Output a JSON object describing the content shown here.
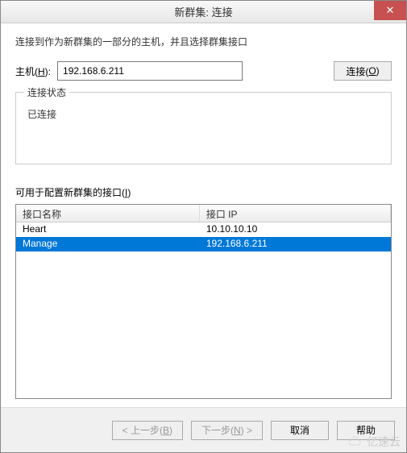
{
  "window": {
    "title": "新群集: 连接",
    "close_icon": "✕"
  },
  "instruction": "连接到作为新群集的一部分的主机，并且选择群集接口",
  "host": {
    "label_prefix": "主机(",
    "label_key": "H",
    "label_suffix": "):",
    "value": "192.168.6.211"
  },
  "connect_btn": {
    "label_prefix": "连接(",
    "label_key": "O",
    "label_suffix": ")"
  },
  "status_box": {
    "legend": "连接状态",
    "text": "已连接"
  },
  "interfaces": {
    "label_prefix": "可用于配置新群集的接口(",
    "label_key": "I",
    "label_suffix": ")",
    "columns": {
      "name": "接口名称",
      "ip": "接口 IP"
    },
    "rows": [
      {
        "name": "Heart",
        "ip": "10.10.10.10",
        "selected": false
      },
      {
        "name": "Manage",
        "ip": "192.168.6.211",
        "selected": true
      }
    ]
  },
  "footer": {
    "back": {
      "prefix": "< 上一步(",
      "key": "B",
      "suffix": ")"
    },
    "next": {
      "prefix": "下一步(",
      "key": "N",
      "suffix": ") >"
    },
    "cancel": "取消",
    "help": "帮助"
  },
  "watermark": "亿速云"
}
